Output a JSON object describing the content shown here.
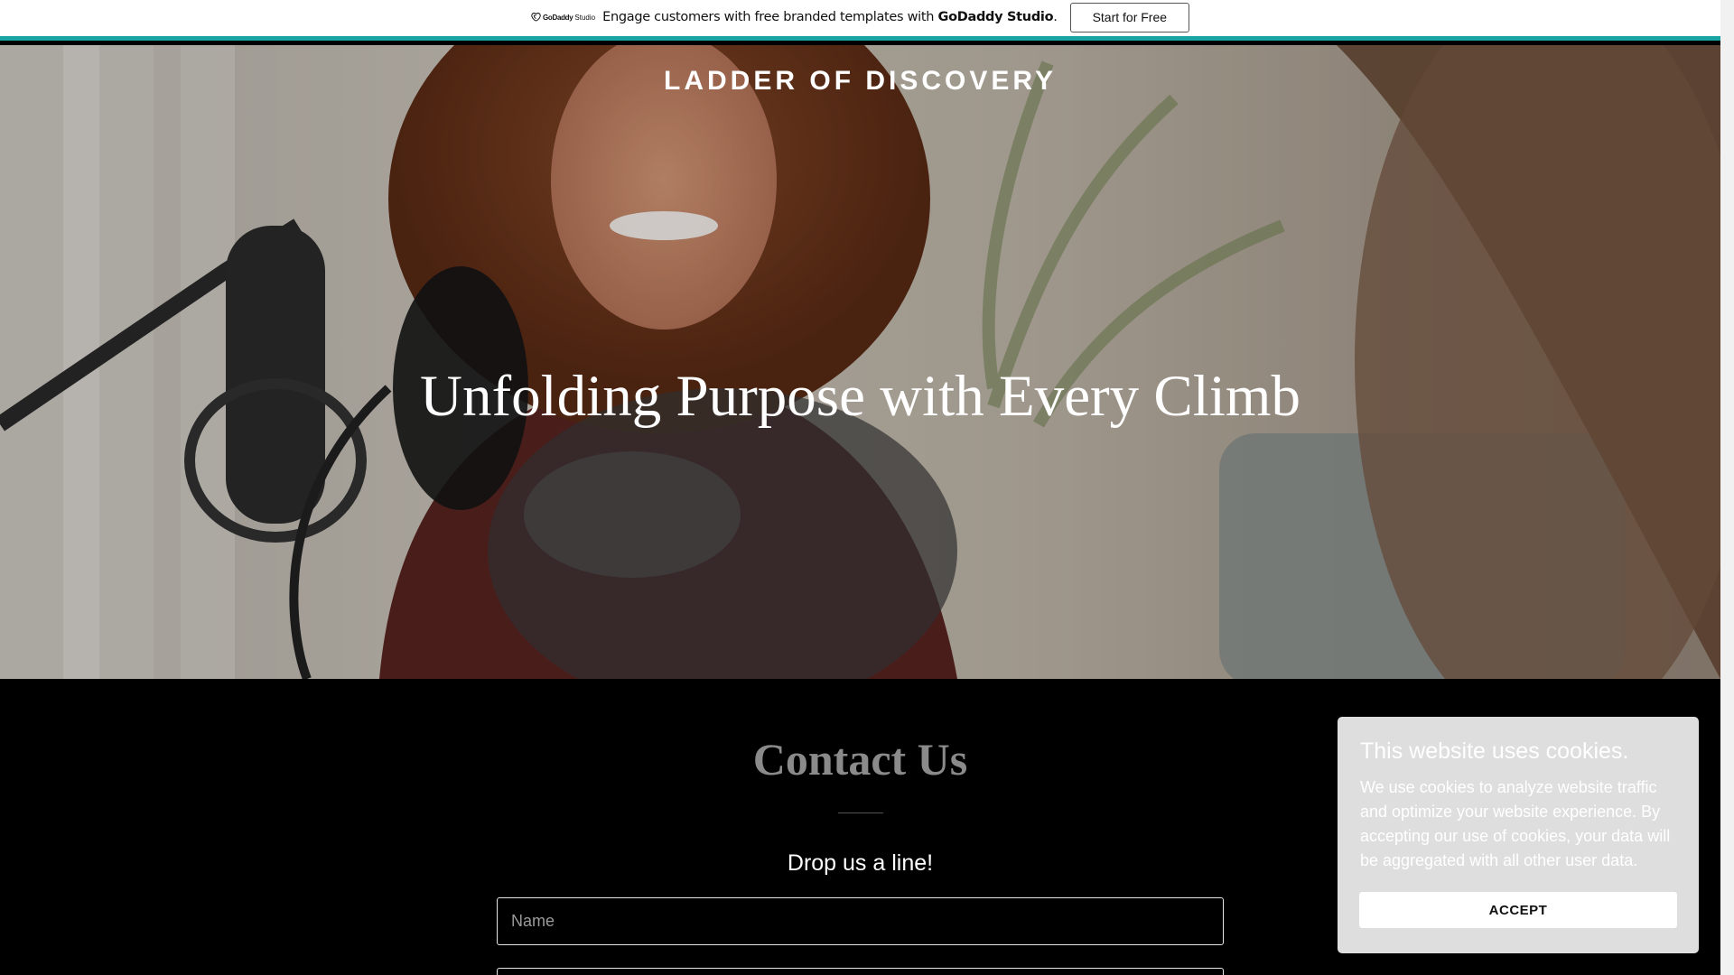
{
  "promo": {
    "logo_brand": "GoDaddy",
    "logo_product": "Studio",
    "text_before": "Engage customers with free branded templates with ",
    "text_bold": "GoDaddy Studio",
    "text_after": ".",
    "button_label": "Start for Free"
  },
  "hero": {
    "site_title": "LADDER OF DISCOVERY",
    "heading": "Unfolding Purpose with Every Climb"
  },
  "contact": {
    "title": "Contact Us",
    "subtitle": "Drop us a line!",
    "name_placeholder": "Name",
    "second_placeholder": ""
  },
  "cookie": {
    "title": "This website uses cookies.",
    "body": "We use cookies to analyze website traffic and optimize your website experience. By accepting our use of cookies, your data will be aggregated with all other user data.",
    "accept_label": "ACCEPT"
  },
  "colors": {
    "promo_accent": "#1aa4a4",
    "contact_bg": "#000000",
    "cookie_bg": "#dedede"
  }
}
